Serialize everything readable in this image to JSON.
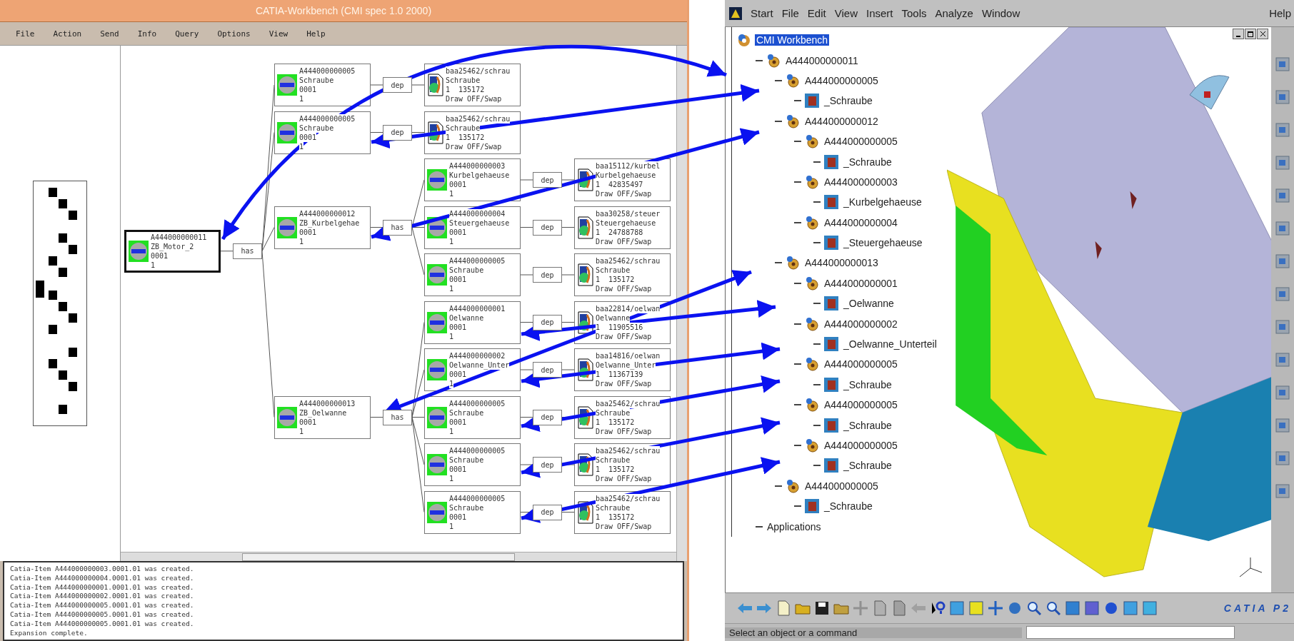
{
  "workbench_window": {
    "title": "CATIA-Workbench (CMI spec 1.0 2000)",
    "menu": [
      "File",
      "Action",
      "Send",
      "Info",
      "Query",
      "Options",
      "View",
      "Help"
    ],
    "diagram": {
      "root": {
        "item": "A444000000011",
        "name": "ZB_Motor_2",
        "version": "0001",
        "count": "1",
        "selected": true,
        "relation": "has",
        "children": [
          {
            "item": "A444000000005",
            "name": "Schraube",
            "version": "0001",
            "count": "1",
            "selected": false,
            "relation": "dep",
            "document": {
              "file": "baa25462/schrau",
              "name": "Schraube",
              "size": "1  135172",
              "status": "Draw OFF/Swap"
            }
          },
          {
            "item": "A444000000005",
            "name": "Schraube",
            "version": "0001",
            "count": "1",
            "selected": false,
            "relation": "dep",
            "document": {
              "file": "baa25462/schrau",
              "name": "Schraube",
              "size": "1  135172",
              "status": "Draw OFF/Swap"
            }
          },
          {
            "item": "A444000000012",
            "name": "ZB_Kurbelgehae",
            "version": "0001",
            "count": "1",
            "selected": false,
            "relation": "has",
            "children": [
              {
                "item": "A444000000003",
                "name": "Kurbelgehaeuse",
                "version": "0001",
                "count": "1",
                "selected": false,
                "relation": "dep",
                "document": {
                  "file": "baa15112/kurbel",
                  "name": "Kurbelgehaeuse",
                  "size": "1  42835497",
                  "status": "Draw OFF/Swap"
                }
              },
              {
                "item": "A444000000004",
                "name": "Steuergehaeuse",
                "version": "0001",
                "count": "1",
                "selected": false,
                "relation": "dep",
                "document": {
                  "file": "baa30258/steuer",
                  "name": "Steuergehaeuse",
                  "size": "1  24788788",
                  "status": "Draw OFF/Swap"
                }
              },
              {
                "item": "A444000000005",
                "name": "Schraube",
                "version": "0001",
                "count": "1",
                "selected": false,
                "relation": "dep",
                "document": {
                  "file": "baa25462/schrau",
                  "name": "Schraube",
                  "size": "1  135172",
                  "status": "Draw OFF/Swap"
                }
              }
            ]
          },
          {
            "item": "A444000000013",
            "name": "ZB_Oelwanne",
            "version": "0001",
            "count": "1",
            "selected": false,
            "relation": "has",
            "children": [
              {
                "item": "A444000000001",
                "name": "Oelwanne",
                "version": "0001",
                "count": "1",
                "selected": false,
                "relation": "dep",
                "document": {
                  "file": "baa22814/oelwan",
                  "name": "Oelwanne",
                  "size": "1  11905516",
                  "status": "Draw OFF/Swap"
                }
              },
              {
                "item": "A444000000002",
                "name": "Oelwanne_Unter",
                "version": "0001",
                "count": "1",
                "selected": false,
                "relation": "dep",
                "document": {
                  "file": "baa14816/oelwan",
                  "name": "Oelwanne_Unter",
                  "size": "1  11367139",
                  "status": "Draw OFF/Swap"
                }
              },
              {
                "item": "A444000000005",
                "name": "Schraube",
                "version": "0001",
                "count": "1",
                "selected": false,
                "relation": "dep",
                "document": {
                  "file": "baa25462/schrau",
                  "name": "Schraube",
                  "size": "1  135172",
                  "status": "Draw OFF/Swap"
                }
              },
              {
                "item": "A444000000005",
                "name": "Schraube",
                "version": "0001",
                "count": "1",
                "selected": false,
                "relation": "dep",
                "document": {
                  "file": "baa25462/schrau",
                  "name": "Schraube",
                  "size": "1  135172",
                  "status": "Draw OFF/Swap"
                }
              },
              {
                "item": "A444000000005",
                "name": "Schraube",
                "version": "0001",
                "count": "1",
                "selected": false,
                "relation": "dep",
                "document": {
                  "file": "baa25462/schrau",
                  "name": "Schraube",
                  "size": "1  135172",
                  "status": "Draw OFF/Swap"
                }
              }
            ]
          }
        ]
      }
    },
    "log": [
      "Catia-Item A444000000003.0001.01 was created.",
      "Catia-Item A444000000004.0001.01 was created.",
      "Catia-Item A444000000001.0001.01 was created.",
      "Catia-Item A444000000002.0001.01 was created.",
      "Catia-Item A444000000005.0001.01 was created.",
      "Catia-Item A444000000005.0001.01 was created.",
      "Catia-Item A444000000005.0001.01 was created.",
      "Expansion complete."
    ]
  },
  "catia_window": {
    "menu": [
      "Start",
      "File",
      "Edit",
      "View",
      "Insert",
      "Tools",
      "Analyze",
      "Window"
    ],
    "help_menu": "Help",
    "tree": {
      "label": "CMI Workbench",
      "kind": "root",
      "selected": true,
      "children": [
        {
          "label": "A444000000011",
          "kind": "product",
          "selected": false,
          "children": [
            {
              "label": "A444000000005",
              "kind": "product",
              "selected": false,
              "children": [
                {
                  "label": "_Schraube",
                  "kind": "part",
                  "selected": false
                }
              ]
            },
            {
              "label": "A444000000012",
              "kind": "product",
              "selected": false,
              "children": [
                {
                  "label": "A444000000005",
                  "kind": "product",
                  "selected": false,
                  "children": [
                    {
                      "label": "_Schraube",
                      "kind": "part",
                      "selected": false
                    }
                  ]
                },
                {
                  "label": "A444000000003",
                  "kind": "product",
                  "selected": false,
                  "children": [
                    {
                      "label": "_Kurbelgehaeuse",
                      "kind": "part",
                      "selected": false
                    }
                  ]
                },
                {
                  "label": "A444000000004",
                  "kind": "product",
                  "selected": false,
                  "children": [
                    {
                      "label": "_Steuergehaeuse",
                      "kind": "part",
                      "selected": false
                    }
                  ]
                }
              ]
            },
            {
              "label": "A444000000013",
              "kind": "product",
              "selected": false,
              "children": [
                {
                  "label": "A444000000001",
                  "kind": "product",
                  "selected": false,
                  "children": [
                    {
                      "label": "_Oelwanne",
                      "kind": "part",
                      "selected": false
                    }
                  ]
                },
                {
                  "label": "A444000000002",
                  "kind": "product",
                  "selected": false,
                  "children": [
                    {
                      "label": "_Oelwanne_Unterteil",
                      "kind": "part",
                      "selected": false
                    }
                  ]
                },
                {
                  "label": "A444000000005",
                  "kind": "product",
                  "selected": false,
                  "children": [
                    {
                      "label": "_Schraube",
                      "kind": "part",
                      "selected": false
                    }
                  ]
                },
                {
                  "label": "A444000000005",
                  "kind": "product",
                  "selected": false,
                  "children": [
                    {
                      "label": "_Schraube",
                      "kind": "part",
                      "selected": false
                    }
                  ]
                },
                {
                  "label": "A444000000005",
                  "kind": "product",
                  "selected": false,
                  "children": [
                    {
                      "label": "_Schraube",
                      "kind": "part",
                      "selected": false
                    }
                  ]
                }
              ]
            },
            {
              "label": "A444000000005",
              "kind": "product",
              "selected": false,
              "children": [
                {
                  "label": "_Schraube",
                  "kind": "part",
                  "selected": false
                }
              ]
            }
          ]
        },
        {
          "label": "Applications",
          "kind": "folder",
          "selected": false
        }
      ]
    },
    "logo": "CATIA P2",
    "status": "Select an object or a command"
  }
}
